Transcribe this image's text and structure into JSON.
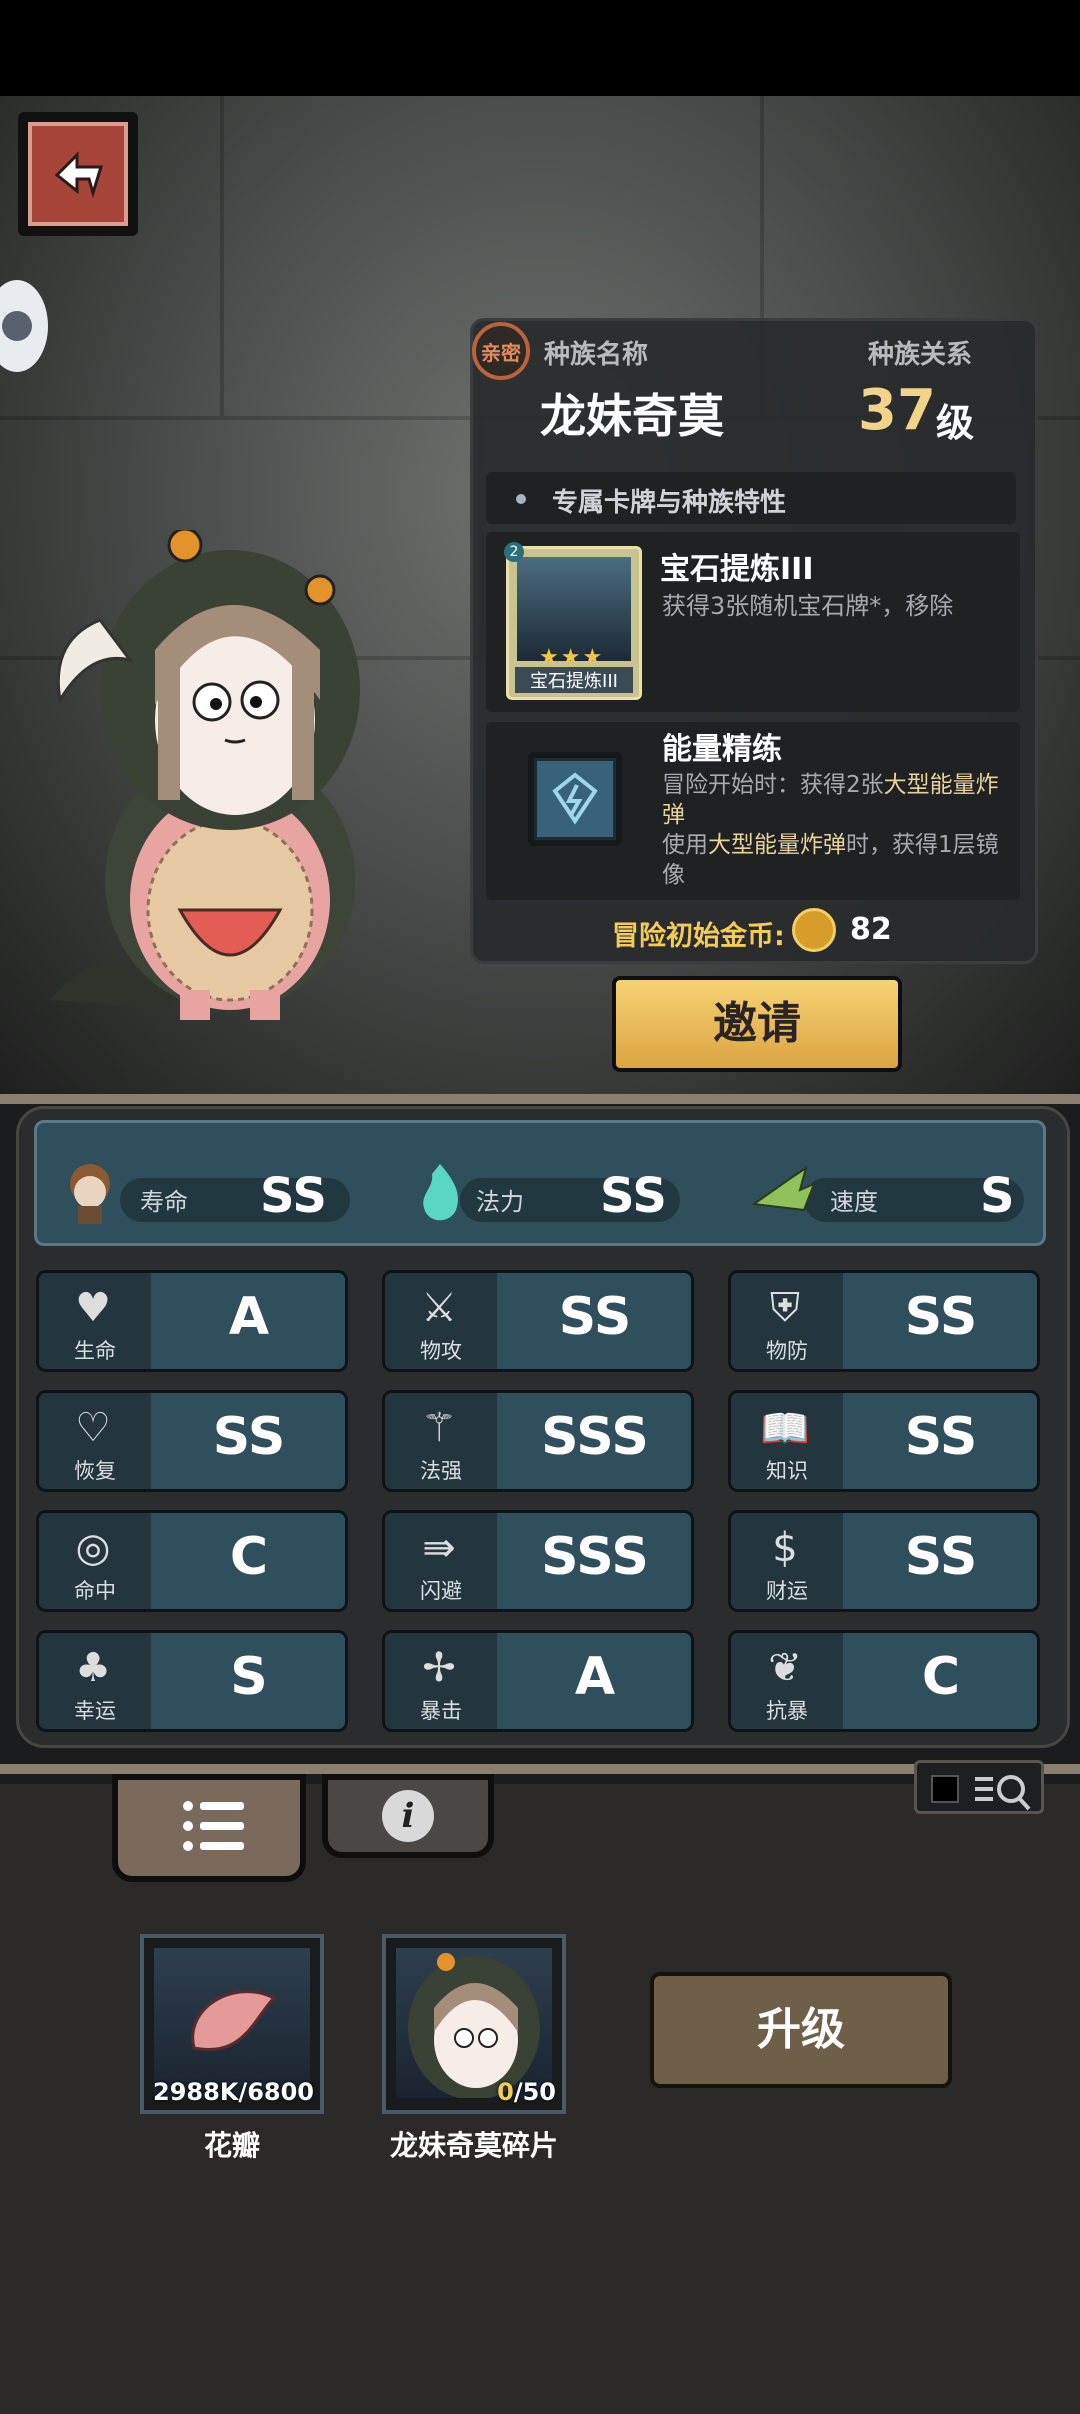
{
  "header": {
    "back_label": "back",
    "bubble_label": "chat"
  },
  "race_panel": {
    "intimacy_badge": "亲密",
    "race_name_label": "种族名称",
    "race_relation_label": "种族关系",
    "race_name": "龙妹奇莫",
    "relation_level": "37",
    "relation_unit": "级",
    "section_title": "专属卡牌与种族特性",
    "card": {
      "badge": "2",
      "name": "宝石提炼III",
      "card_label": "宝石提炼III",
      "stars": "★★★",
      "description": "获得3张随机宝石牌*，移除"
    },
    "trait": {
      "name": "能量精练",
      "desc_line1_prefix": "冒险开始时：获得2张",
      "desc_line1_highlight": "大型能量炸弹",
      "desc_line2_prefix": "使用",
      "desc_line2_highlight": "大型能量炸弹",
      "desc_line2_suffix": "时，获得1层镜像"
    },
    "start_gold_label": "冒险初始金币:",
    "start_gold_value": "82",
    "invite_label": "邀请"
  },
  "top_stats": [
    {
      "name": "寿命",
      "grade": "SS",
      "icon": "character-icon"
    },
    {
      "name": "法力",
      "grade": "SS",
      "icon": "flame-icon"
    },
    {
      "name": "速度",
      "grade": "S",
      "icon": "wing-boot-icon"
    }
  ],
  "stats": [
    {
      "name": "生命",
      "grade": "A",
      "icon": "♥"
    },
    {
      "name": "物攻",
      "grade": "SS",
      "icon": "⚔"
    },
    {
      "name": "物防",
      "grade": "SS",
      "icon": "⛨"
    },
    {
      "name": "恢复",
      "grade": "SS",
      "icon": "♡"
    },
    {
      "name": "法强",
      "grade": "SSS",
      "icon": "⚚"
    },
    {
      "name": "知识",
      "grade": "SS",
      "icon": "📖"
    },
    {
      "name": "命中",
      "grade": "C",
      "icon": "◎"
    },
    {
      "name": "闪避",
      "grade": "SSS",
      "icon": "⇛"
    },
    {
      "name": "财运",
      "grade": "SS",
      "icon": "$"
    },
    {
      "name": "幸运",
      "grade": "S",
      "icon": "♣"
    },
    {
      "name": "暴击",
      "grade": "A",
      "icon": "✢"
    },
    {
      "name": "抗暴",
      "grade": "C",
      "icon": "❦"
    }
  ],
  "tabs": {
    "list_icon": "list-icon",
    "info_icon": "info-icon",
    "info_glyph": "i"
  },
  "materials": [
    {
      "name": "花瓣",
      "count": "2988K/6800"
    },
    {
      "name": "龙妹奇莫碎片",
      "count_current": "0",
      "count_total": "/50"
    }
  ],
  "upgrade_label": "升级",
  "colors": {
    "accent_gold": "#f3cc57",
    "button_gold": "#dca340",
    "stat_teal": "#2f4f5c",
    "upgrade_brown": "#6e5f48"
  }
}
